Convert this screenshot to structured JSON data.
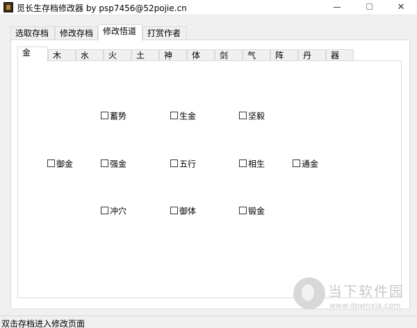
{
  "window": {
    "title": "觅长生存档修改器 by psp7456@52pojie.cn",
    "icon": "app-icon",
    "minimize_glyph": "minimize-icon",
    "maximize_glyph": "maximize-icon",
    "close_label": "✕"
  },
  "outer_tabs": [
    "选取存档",
    "修改存档",
    "修改悟道",
    "打赏作者"
  ],
  "outer_active": "修改悟道",
  "inner_tabs": [
    "金",
    "木",
    "水",
    "火",
    "土",
    "神",
    "体",
    "剑",
    "气",
    "阵",
    "丹",
    "器"
  ],
  "inner_active": "金",
  "checkboxes": {
    "row1": [
      "蓄势",
      "生金",
      "坚毅"
    ],
    "row2": [
      "御金",
      "强金",
      "五行",
      "相生",
      "通金"
    ],
    "row3": [
      "冲穴",
      "御体",
      "锻金"
    ]
  },
  "status": "双击存档进入修改页面",
  "watermark": {
    "title": "当下软件园",
    "url": "www.downxia.com"
  }
}
